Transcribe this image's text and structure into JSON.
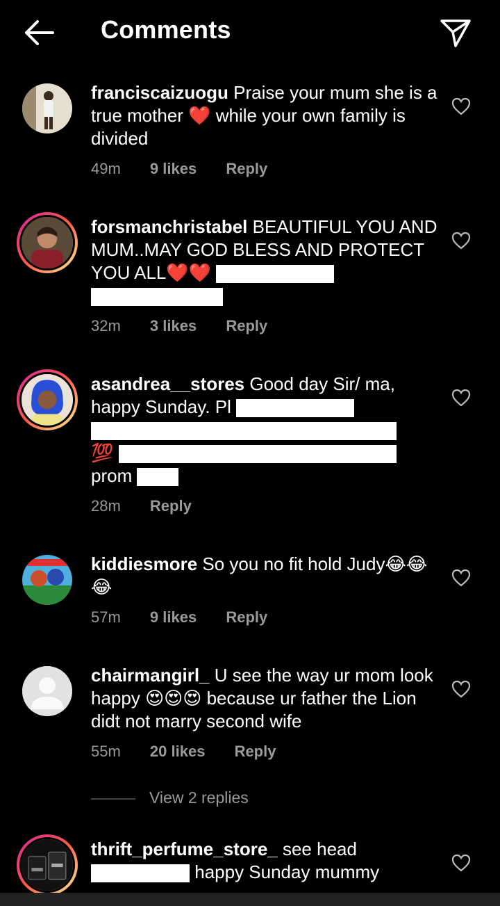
{
  "header": {
    "title": "Comments"
  },
  "comments": [
    {
      "username": "franciscaizuogu",
      "text": "Praise your mum she is a true mother ❤️ while your own family is divided",
      "time": "49m",
      "likes": "9 likes",
      "reply": "Reply"
    },
    {
      "username": "forsmanchristabel",
      "text": "BEAUTIFUL YOU AND MUM..MAY GOD BLESS AND PROTECT YOU ALL❤️❤️",
      "time": "32m",
      "likes": "3 likes",
      "reply": "Reply"
    },
    {
      "username": "asandrea__stores",
      "text": "Good day Sir/ ma, happy Sunday. Pl",
      "text2": "💯",
      "text3": "prom",
      "time": "28m",
      "reply": "Reply"
    },
    {
      "username": "kiddiesmore",
      "text": "So you no fit hold Judy😂😂😂",
      "time": "57m",
      "likes": "9 likes",
      "reply": "Reply"
    },
    {
      "username": "chairmangirl_",
      "text": "U see the way ur mom look happy 😍😍😍 because ur father the Lion didt not marry second wife",
      "time": "55m",
      "likes": "20 likes",
      "reply": "Reply",
      "view_replies": "View 2 replies"
    },
    {
      "username": "thrift_perfume_store_",
      "text": "see head",
      "text2": "happy Sunday mummy"
    }
  ],
  "colors": {
    "background": "#000000",
    "secondary_text": "#9a9a9a",
    "heart_red": "#e0202a"
  }
}
